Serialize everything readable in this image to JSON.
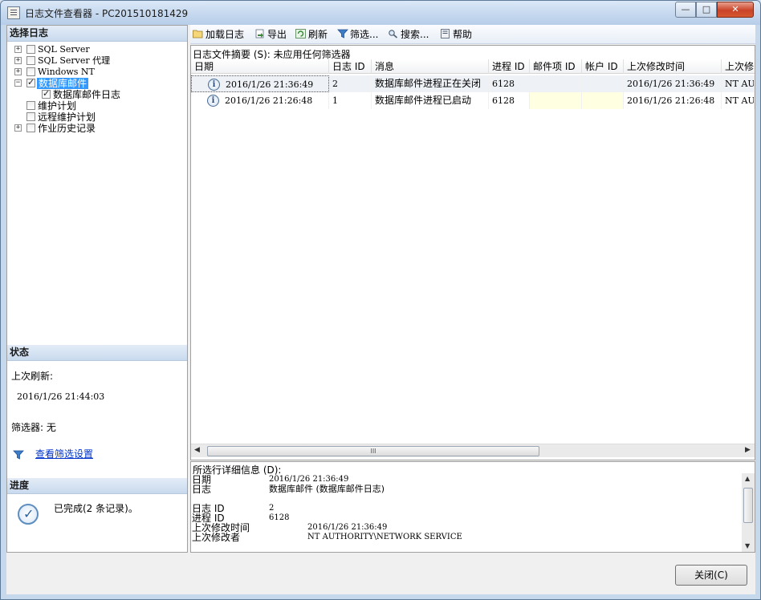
{
  "window": {
    "title": "日志文件查看器 - PC201510181429",
    "min_glyph": "—",
    "max_glyph": "□",
    "close_glyph": "✕"
  },
  "left": {
    "select_log_header": "选择日志",
    "tree": [
      {
        "label": "SQL Server",
        "expander": "+",
        "checked": false
      },
      {
        "label": "SQL Server 代理",
        "expander": "+",
        "checked": false
      },
      {
        "label": "Windows NT",
        "expander": "+",
        "checked": false
      },
      {
        "label": "数据库邮件",
        "expander": "−",
        "checked": true,
        "selected": true
      },
      {
        "label": "数据库邮件日志",
        "checked": true
      },
      {
        "label": "维护计划",
        "checked": false
      },
      {
        "label": "远程维护计划",
        "checked": false
      },
      {
        "label": "作业历史记录",
        "expander": "+",
        "checked": false
      }
    ],
    "status_header": "状态",
    "last_refresh_label": "上次刷新:",
    "last_refresh_value": "2016/1/26 21:44:03",
    "filter_label": "筛选器: 无",
    "view_filter_link": "查看筛选设置",
    "progress_header": "进度",
    "progress_text": "已完成(2 条记录)。"
  },
  "toolbar": {
    "load_log": "加载日志",
    "export": "导出",
    "refresh": "刷新",
    "filter": "筛选...",
    "search": "搜索...",
    "help": "帮助"
  },
  "grid": {
    "summary": "日志文件摘要 (S): 未应用任何筛选器",
    "columns": [
      "日期",
      "日志 ID",
      "消息",
      "进程 ID",
      "邮件项 ID",
      "帐户 ID",
      "上次修改时间",
      "上次修"
    ],
    "rows": [
      {
        "date": "2016/1/26 21:36:49",
        "log_id": "2",
        "message": "数据库邮件进程正在关闭",
        "process_id": "6128",
        "mail_id": "",
        "account_id": "",
        "last_modified": "2016/1/26 21:36:49",
        "last_modified_by": "NT AUT"
      },
      {
        "date": "2016/1/26 21:26:48",
        "log_id": "1",
        "message": "数据库邮件进程已启动",
        "process_id": "6128",
        "mail_id": "",
        "account_id": "",
        "last_modified": "2016/1/26 21:26:48",
        "last_modified_by": "NT AUT"
      }
    ],
    "hscroll_grip": "III"
  },
  "details": {
    "title": "所选行详细信息 (D):",
    "lines": [
      {
        "key": "日期",
        "value": "2016/1/26 21:36:49"
      },
      {
        "key": "日志",
        "value": "数据库邮件 (数据库邮件日志)"
      },
      {
        "key": "日志 ID",
        "value": "2"
      },
      {
        "key": "进程 ID",
        "value": "6128"
      },
      {
        "key": "上次修改时间",
        "value": "2016/1/26 21:36:49"
      },
      {
        "key": "上次修改者",
        "value": "NT AUTHORITY\\NETWORK SERVICE"
      }
    ]
  },
  "footer": {
    "close_button": "关闭(C)"
  },
  "colors": {
    "selection": "#3399ff",
    "link": "#0033cc",
    "section_header": "#c9daee"
  }
}
